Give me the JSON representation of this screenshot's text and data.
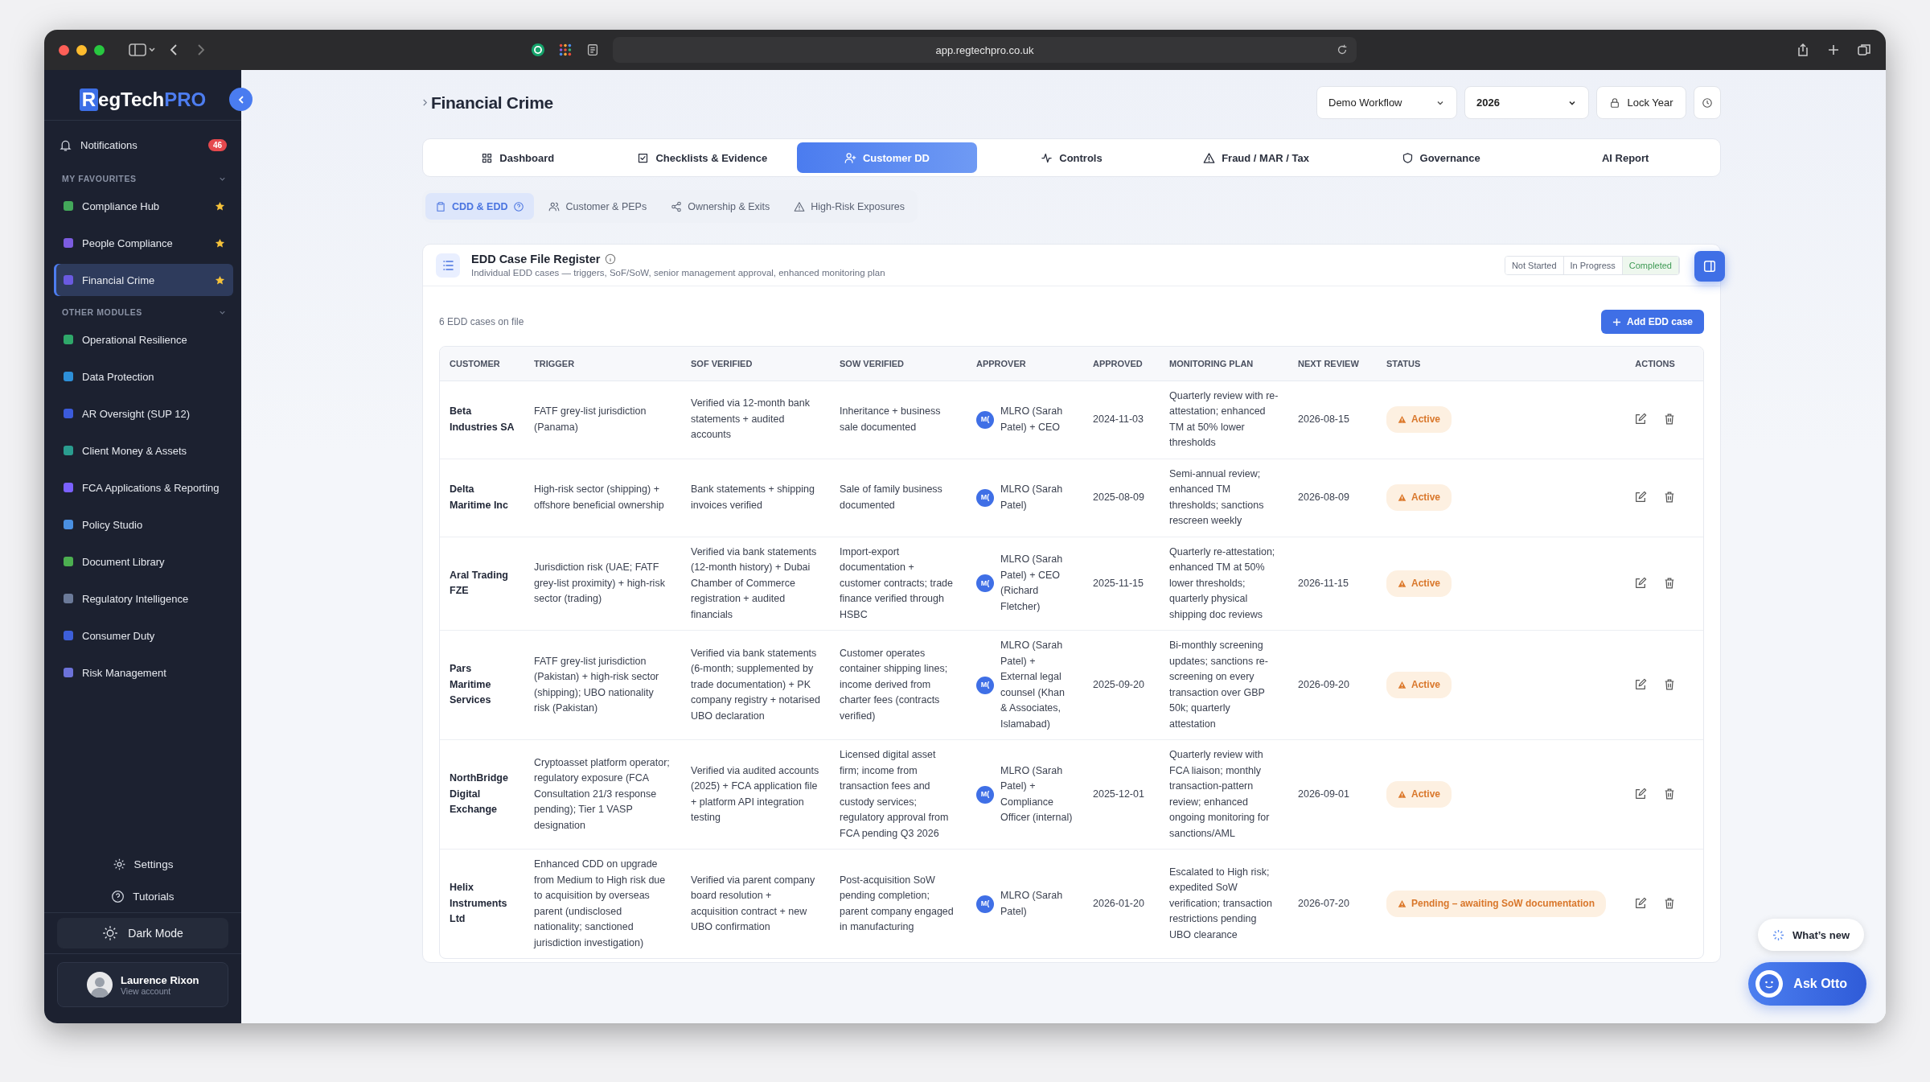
{
  "browser": {
    "url": "app.regtechpro.co.uk"
  },
  "sidebar": {
    "logo": {
      "mark": "R",
      "text": "egTech",
      "accent": "PRO"
    },
    "notifications": {
      "label": "Notifications",
      "count": "46"
    },
    "sections": [
      {
        "title": "MY FAVOURITES",
        "expanded": true,
        "items": [
          {
            "label": "Compliance Hub",
            "color": "#43a85a",
            "favourite": true,
            "selected": false
          },
          {
            "label": "People Compliance",
            "color": "#7c5ce0",
            "favourite": true,
            "selected": false
          },
          {
            "label": "Financial Crime",
            "color": "#6a5ae0",
            "favourite": true,
            "selected": true
          }
        ]
      },
      {
        "title": "OTHER MODULES",
        "expanded": true,
        "items": [
          {
            "label": "Operational Resilience",
            "color": "#2fa86a",
            "favourite": false,
            "selected": false
          },
          {
            "label": "Data Protection",
            "color": "#2d8fd8",
            "favourite": false,
            "selected": false
          },
          {
            "label": "AR Oversight (SUP 12)",
            "color": "#3b5bdb",
            "favourite": false,
            "selected": false
          },
          {
            "label": "Client Money & Assets",
            "color": "#2a9d8f",
            "favourite": false,
            "selected": false
          },
          {
            "label": "FCA Applications & Reporting",
            "color": "#7b61ff",
            "favourite": false,
            "selected": false
          },
          {
            "label": "Policy Studio",
            "color": "#4a90e2",
            "favourite": false,
            "selected": false
          },
          {
            "label": "Document Library",
            "color": "#4caf50",
            "favourite": false,
            "selected": false
          },
          {
            "label": "Regulatory Intelligence",
            "color": "#6b7a99",
            "favourite": false,
            "selected": false
          },
          {
            "label": "Consumer Duty",
            "color": "#3d5fd9",
            "favourite": false,
            "selected": false
          },
          {
            "label": "Risk Management",
            "color": "#6c72d9",
            "favourite": false,
            "selected": false
          }
        ]
      }
    ],
    "footer_links": [
      "Settings",
      "Tutorials"
    ],
    "theme_toggle": "Dark Mode",
    "user": {
      "name": "Laurence Rixon",
      "subtitle": "View account"
    }
  },
  "page": {
    "title": "Financial Crime",
    "workflow": "Demo Workflow",
    "year": "2026",
    "lock": "Lock Year"
  },
  "tabs": [
    {
      "label": "Dashboard",
      "selected": false
    },
    {
      "label": "Checklists & Evidence",
      "selected": false
    },
    {
      "label": "Customer DD",
      "selected": true
    },
    {
      "label": "Controls",
      "selected": false
    },
    {
      "label": "Fraud / MAR / Tax",
      "selected": false
    },
    {
      "label": "Governance",
      "selected": false
    },
    {
      "label": "AI Report",
      "selected": false
    }
  ],
  "subtabs": [
    {
      "label": "CDD & EDD",
      "selected": true
    },
    {
      "label": "Customer & PEPs",
      "selected": false
    },
    {
      "label": "Ownership & Exits",
      "selected": false
    },
    {
      "label": "High-Risk Exposures",
      "selected": false
    }
  ],
  "card": {
    "title": "EDD Case File Register",
    "subtitle": "Individual EDD cases — triggers, SoF/SoW, senior management approval, enhanced monitoring plan",
    "filters": [
      {
        "label": "Not Started",
        "selected": false
      },
      {
        "label": "In Progress",
        "selected": false
      },
      {
        "label": "Completed",
        "selected": true
      }
    ],
    "count": "6 EDD cases on file",
    "add_button": "Add EDD case"
  },
  "table": {
    "columns": [
      "CUSTOMER",
      "TRIGGER",
      "SOF VERIFIED",
      "SOW VERIFIED",
      "APPROVER",
      "APPROVED",
      "MONITORING PLAN",
      "NEXT REVIEW",
      "STATUS",
      "ACTIONS"
    ],
    "rows": [
      {
        "customer": "Beta Industries SA",
        "trigger": "FATF grey-list jurisdiction (Panama)",
        "sof": "Verified via 12-month bank statements + audited accounts",
        "sow": "Inheritance + business sale documented",
        "initials": "M(",
        "approver": "MLRO (Sarah Patel) + CEO",
        "approved": "2024-11-03",
        "monitoring": "Quarterly review with re-attestation; enhanced TM at 50% lower thresholds",
        "next_review": "2026-08-15",
        "status": "Active"
      },
      {
        "customer": "Delta Maritime Inc",
        "trigger": "High-risk sector (shipping) + offshore beneficial ownership",
        "sof": "Bank statements + shipping invoices verified",
        "sow": "Sale of family business documented",
        "initials": "M(",
        "approver": "MLRO (Sarah Patel)",
        "approved": "2025-08-09",
        "monitoring": "Semi-annual review; enhanced TM thresholds; sanctions rescreen weekly",
        "next_review": "2026-08-09",
        "status": "Active"
      },
      {
        "customer": "Aral Trading FZE",
        "trigger": "Jurisdiction risk (UAE; FATF grey-list proximity) + high-risk sector (trading)",
        "sof": "Verified via bank statements (12-month history) + Dubai Chamber of Commerce registration + audited financials",
        "sow": "Import-export documentation + customer contracts; trade finance verified through HSBC",
        "initials": "M(",
        "approver": "MLRO (Sarah Patel) + CEO (Richard Fletcher)",
        "approved": "2025-11-15",
        "monitoring": "Quarterly re-attestation; enhanced TM at 50% lower thresholds; quarterly physical shipping doc reviews",
        "next_review": "2026-11-15",
        "status": "Active"
      },
      {
        "customer": "Pars Maritime Services",
        "trigger": "FATF grey-list jurisdiction (Pakistan) + high-risk sector (shipping); UBO nationality risk (Pakistan)",
        "sof": "Verified via bank statements (6-month; supplemented by trade documentation) + PK company registry + notarised UBO declaration",
        "sow": "Customer operates container shipping lines; income derived from charter fees (contracts verified)",
        "initials": "M(",
        "approver": "MLRO (Sarah Patel) + External legal counsel (Khan & Associates, Islamabad)",
        "approved": "2025-09-20",
        "monitoring": "Bi-monthly screening updates; sanctions re-screening on every transaction over GBP 50k; quarterly attestation",
        "next_review": "2026-09-20",
        "status": "Active"
      },
      {
        "customer": "NorthBridge Digital Exchange",
        "trigger": "Cryptoasset platform operator; regulatory exposure (FCA Consultation 21/3 response pending); Tier 1 VASP designation",
        "sof": "Verified via audited accounts (2025) + FCA application file + platform API integration testing",
        "sow": "Licensed digital asset firm; income from transaction fees and custody services; regulatory approval from FCA pending Q3 2026",
        "initials": "M(",
        "approver": "MLRO (Sarah Patel) + Compliance Officer (internal)",
        "approved": "2025-12-01",
        "monitoring": "Quarterly review with FCA liaison; monthly transaction-pattern review; enhanced ongoing monitoring for sanctions/AML",
        "next_review": "2026-09-01",
        "status": "Active"
      },
      {
        "customer": "Helix Instruments Ltd",
        "trigger": "Enhanced CDD on upgrade from Medium to High risk due to acquisition by overseas parent (undisclosed nationality; sanctioned jurisdiction investigation)",
        "sof": "Verified via parent company board resolution + acquisition contract + new UBO confirmation",
        "sow": "Post-acquisition SoW pending completion; parent company engaged in manufacturing",
        "initials": "M(",
        "approver": "MLRO (Sarah Patel)",
        "approved": "2026-01-20",
        "monitoring": "Escalated to High risk; expedited SoW verification; transaction restrictions pending UBO clearance",
        "next_review": "2026-07-20",
        "status": "Pending – awaiting SoW documentation"
      }
    ]
  },
  "floating": {
    "whats_new": "What’s new",
    "assistant": "Ask Otto"
  }
}
